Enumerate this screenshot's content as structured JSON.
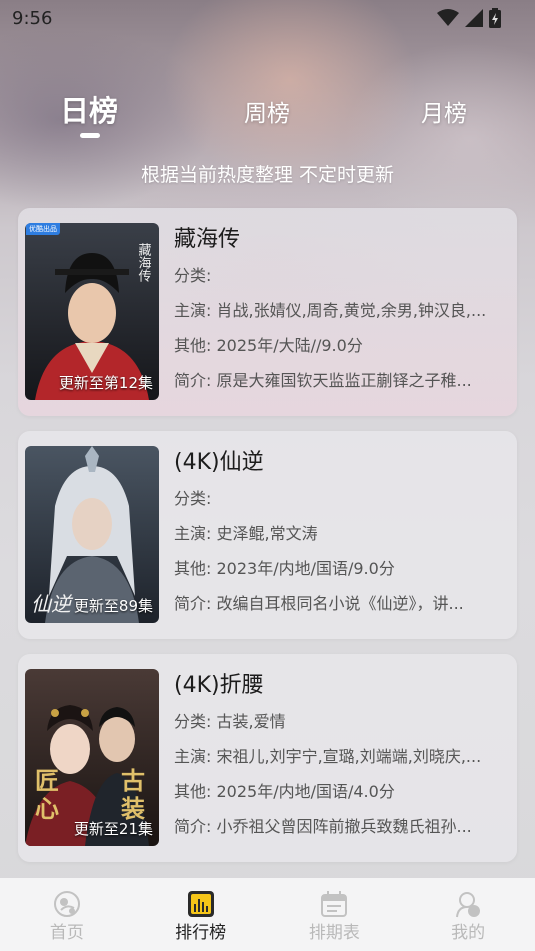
{
  "status_bar": {
    "time": "9:56"
  },
  "tabs": [
    {
      "label": "日榜",
      "active": true
    },
    {
      "label": "周榜",
      "active": false
    },
    {
      "label": "月榜",
      "active": false
    }
  ],
  "subtitle": "根据当前热度整理 不定时更新",
  "poster_badge": "优酷出品",
  "items": [
    {
      "title": "藏海传",
      "episode": "更新至第12集",
      "category": "分类:",
      "cast": "主演:  肖战,张婧仪,周奇,黄觉,余男,钟汉良,...",
      "other": "其他:  2025年/大陆//9.0分",
      "intro": "简介:  原是大雍国钦天监监正蒯铎之子稚..."
    },
    {
      "title": "(4K)仙逆",
      "episode": "更新至89集",
      "category": "分类:",
      "cast": "主演:  史泽鲲,常文涛",
      "other": "其他:  2023年/内地/国语/9.0分",
      "intro": "简介:  改编自耳根同名小说《仙逆》，讲..."
    },
    {
      "title": "(4K)折腰",
      "episode": "更新至21集",
      "category": "分类:  古装,爱情",
      "cast": "主演:  宋祖儿,刘宇宁,宣璐,刘端端,刘晓庆,...",
      "other": "其他:  2025年/内地/国语/4.0分",
      "intro": "简介:  小乔祖父曾因阵前撤兵致魏氏祖孙..."
    }
  ],
  "bottom_nav": [
    {
      "label": "首页",
      "icon": "home-icon",
      "active": false
    },
    {
      "label": "排行榜",
      "icon": "ranking-icon",
      "active": true
    },
    {
      "label": "排期表",
      "icon": "schedule-icon",
      "active": false
    },
    {
      "label": "我的",
      "icon": "profile-icon",
      "active": false
    }
  ],
  "colors": {
    "accent": "#f5c518",
    "inactive": "#b9b9b9",
    "active_text": "#222222"
  }
}
